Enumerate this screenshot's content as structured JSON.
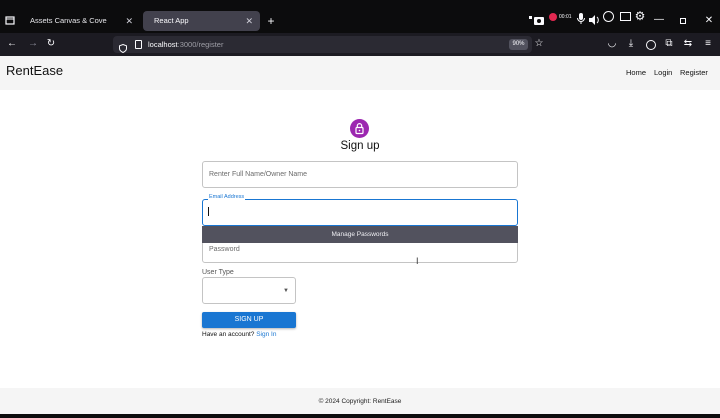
{
  "browser": {
    "tabs": [
      {
        "title": "Assets Canvas & Cove",
        "active": false
      },
      {
        "title": "React App",
        "active": true
      }
    ],
    "url": {
      "host": "localhost",
      "rest": ":3000/register"
    },
    "zoom": "90%",
    "recording_badge": "00:01",
    "icons": [
      "back-icon",
      "forward-icon",
      "reload-icon",
      "shield-icon",
      "page-icon",
      "star-icon",
      "pocket-icon",
      "download-icon",
      "account-icon",
      "extensions-icon",
      "sync-icon",
      "menu-icon",
      "camera-icon",
      "mic-icon",
      "volume-icon",
      "screen-icon",
      "gear-icon"
    ]
  },
  "app": {
    "brand": "RentEase",
    "nav": [
      "Home",
      "Login",
      "Register"
    ],
    "form": {
      "title": "Sign up",
      "name_placeholder": "Renter Full Name/Owner Name",
      "email_label": "Email Address",
      "password_manager": "Manage Passwords",
      "password_placeholder": "Password",
      "user_type_label": "User Type",
      "user_type_value": "",
      "submit_label": "SIGN UP",
      "have_account_text": "Have an account? ",
      "sign_in_link": "Sign In"
    },
    "footer": "© 2024 Copyright: RentEase"
  },
  "colors": {
    "primary": "#1976d2",
    "avatar": "#9c27b0",
    "chrome_dark": "#1c1b22"
  }
}
